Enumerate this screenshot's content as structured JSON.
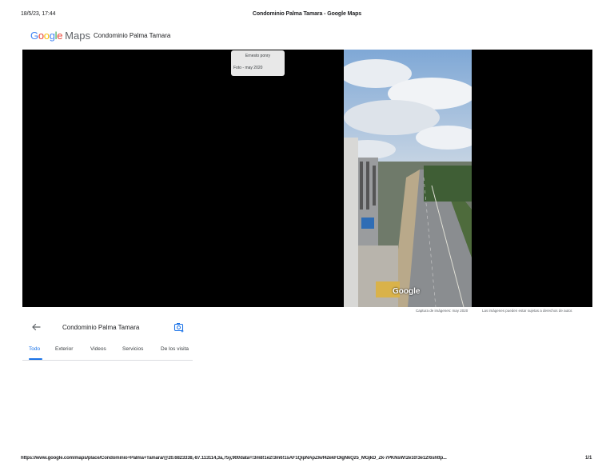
{
  "print_header": {
    "datetime": "18/5/23, 17:44",
    "document_title": "Condominio Palma Tamara - Google Maps"
  },
  "brand": {
    "logo_letters": [
      "G",
      "o",
      "o",
      "g",
      "l",
      "e"
    ],
    "product": "Maps",
    "colors": {
      "blue": "#4285f4",
      "red": "#ea4335",
      "yellow": "#fbbc05",
      "green": "#34a853"
    }
  },
  "place": {
    "name": "Condominio Palma Tamara"
  },
  "photo_viewer": {
    "author": "Ernesto ponry",
    "photo_date": "Foto - may 2020",
    "watermark": "Google",
    "capture_caption": "Captura de imágenes: may 2020",
    "rights_caption": "Las imágenes pueden estar sujetas a derechos de autor."
  },
  "panel": {
    "title": "Condominio Palma Tamara",
    "back_icon": "arrow-left-icon",
    "camera_icon": "add-photo-icon",
    "tabs": [
      {
        "label": "Todo",
        "active": true
      },
      {
        "label": "Exterior",
        "active": false
      },
      {
        "label": "Videos",
        "active": false
      },
      {
        "label": "Servicios",
        "active": false
      },
      {
        "label": "De los visita",
        "active": false
      }
    ]
  },
  "print_footer": {
    "url": "https://www.google.com/maps/place/Condominio+Palma+Tamara/@20.6823338,-87.113114,3a,75y,90t/data=!3m8!1e2!3m6!1sAF1QipNApZlwf42ekFDIgNkQz5_MGjkD_Zk-7PKNsW!2e10!3e12!6shttp...",
    "page": "1/1"
  },
  "accent_color": "#1a73e8"
}
